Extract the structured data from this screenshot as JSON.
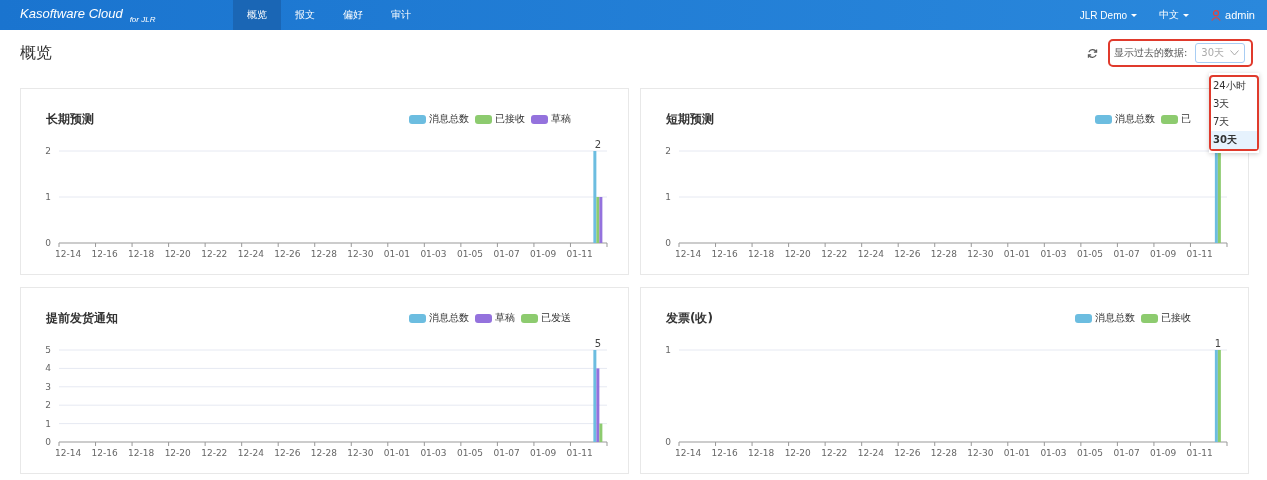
{
  "navbar": {
    "brand": "Kasoftware Cloud",
    "brand_suffix": "for JLR",
    "tabs": [
      {
        "label": "概览",
        "selected": true
      },
      {
        "label": "报文",
        "selected": false
      },
      {
        "label": "偏好",
        "selected": false
      },
      {
        "label": "审计",
        "selected": false
      }
    ],
    "menus": [
      {
        "kind": "dropdown",
        "label": "JLR Demo"
      },
      {
        "kind": "dropdown",
        "label": "中文"
      },
      {
        "kind": "user",
        "label": "admin"
      }
    ]
  },
  "page_title": "概览",
  "filter": {
    "label": "显示过去的数据:",
    "value": "30天",
    "expanded": true,
    "options": [
      {
        "label": "24小时",
        "selected": false
      },
      {
        "label": "3天",
        "selected": false
      },
      {
        "label": "7天",
        "selected": false
      },
      {
        "label": "30天",
        "selected": true
      }
    ]
  },
  "cards": [
    {
      "title": "长期预测",
      "chart_data": {
        "type": "bar",
        "stacked": false,
        "grid": true,
        "ylim": [
          0,
          2
        ],
        "yticks": [
          0,
          1,
          2
        ],
        "categories": [
          "12-14",
          null,
          "12-16",
          null,
          "12-18",
          null,
          "12-20",
          null,
          "12-22",
          null,
          "12-24",
          null,
          "12-26",
          null,
          "12-28",
          null,
          "12-30",
          null,
          "01-01",
          null,
          "01-03",
          null,
          "01-05",
          null,
          "01-07",
          null,
          "01-09",
          null,
          "01-11",
          null
        ],
        "series": [
          {
            "name": "消息总数",
            "color": "#6cbde0",
            "values": [
              0,
              0,
              0,
              0,
              0,
              0,
              0,
              0,
              0,
              0,
              0,
              0,
              0,
              0,
              0,
              0,
              0,
              0,
              0,
              0,
              0,
              0,
              0,
              0,
              0,
              0,
              0,
              0,
              0,
              2
            ]
          },
          {
            "name": "已接收",
            "color": "#8dcb6f",
            "values": [
              0,
              0,
              0,
              0,
              0,
              0,
              0,
              0,
              0,
              0,
              0,
              0,
              0,
              0,
              0,
              0,
              0,
              0,
              0,
              0,
              0,
              0,
              0,
              0,
              0,
              0,
              0,
              0,
              0,
              1
            ]
          },
          {
            "name": "草稿",
            "color": "#9472dd",
            "values": [
              0,
              0,
              0,
              0,
              0,
              0,
              0,
              0,
              0,
              0,
              0,
              0,
              0,
              0,
              0,
              0,
              0,
              0,
              0,
              0,
              0,
              0,
              0,
              0,
              0,
              0,
              0,
              0,
              0,
              1
            ]
          }
        ],
        "value_labels": [
          [
            null,
            null,
            null,
            null,
            null,
            null,
            null,
            null,
            null,
            null,
            null,
            null,
            null,
            null,
            null,
            null,
            null,
            null,
            null,
            null,
            null,
            null,
            null,
            null,
            null,
            null,
            null,
            null,
            null,
            "2"
          ],
          [
            null,
            null,
            null,
            null,
            null,
            null,
            null,
            null,
            null,
            null,
            null,
            null,
            null,
            null,
            null,
            null,
            null,
            null,
            null,
            null,
            null,
            null,
            null,
            null,
            null,
            null,
            null,
            null,
            null,
            null
          ],
          [
            null,
            null,
            null,
            null,
            null,
            null,
            null,
            null,
            null,
            null,
            null,
            null,
            null,
            null,
            null,
            null,
            null,
            null,
            null,
            null,
            null,
            null,
            null,
            null,
            null,
            null,
            null,
            null,
            null,
            null
          ]
        ]
      }
    },
    {
      "title": "短期预测",
      "chart_data": {
        "type": "bar",
        "stacked": false,
        "grid": true,
        "ylim": [
          0,
          2
        ],
        "yticks": [
          0,
          1,
          2
        ],
        "categories": [
          "12-14",
          null,
          "12-16",
          null,
          "12-18",
          null,
          "12-20",
          null,
          "12-22",
          null,
          "12-24",
          null,
          "12-26",
          null,
          "12-28",
          null,
          "12-30",
          null,
          "01-01",
          null,
          "01-03",
          null,
          "01-05",
          null,
          "01-07",
          null,
          "01-09",
          null,
          "01-11",
          null
        ],
        "series": [
          {
            "name": "消息总数",
            "color": "#6cbde0",
            "values": [
              0,
              0,
              0,
              0,
              0,
              0,
              0,
              0,
              0,
              0,
              0,
              0,
              0,
              0,
              0,
              0,
              0,
              0,
              0,
              0,
              0,
              0,
              0,
              0,
              0,
              0,
              0,
              0,
              0,
              2
            ]
          },
          {
            "name": "已",
            "color": "#8dcb6f",
            "values": [
              0,
              0,
              0,
              0,
              0,
              0,
              0,
              0,
              0,
              0,
              0,
              0,
              0,
              0,
              0,
              0,
              0,
              0,
              0,
              0,
              0,
              0,
              0,
              0,
              0,
              0,
              0,
              0,
              0,
              2
            ]
          }
        ]
      }
    },
    {
      "title": "提前发货通知",
      "chart_data": {
        "type": "bar",
        "stacked": false,
        "grid": true,
        "ylim": [
          0,
          5
        ],
        "yticks": [
          0,
          1,
          2,
          3,
          4,
          5
        ],
        "categories": [
          "12-14",
          null,
          "12-16",
          null,
          "12-18",
          null,
          "12-20",
          null,
          "12-22",
          null,
          "12-24",
          null,
          "12-26",
          null,
          "12-28",
          null,
          "12-30",
          null,
          "01-01",
          null,
          "01-03",
          null,
          "01-05",
          null,
          "01-07",
          null,
          "01-09",
          null,
          "01-11",
          null
        ],
        "series": [
          {
            "name": "消息总数",
            "color": "#6cbde0",
            "values": [
              0,
              0,
              0,
              0,
              0,
              0,
              0,
              0,
              0,
              0,
              0,
              0,
              0,
              0,
              0,
              0,
              0,
              0,
              0,
              0,
              0,
              0,
              0,
              0,
              0,
              0,
              0,
              0,
              0,
              5
            ]
          },
          {
            "name": "草稿",
            "color": "#9472dd",
            "values": [
              0,
              0,
              0,
              0,
              0,
              0,
              0,
              0,
              0,
              0,
              0,
              0,
              0,
              0,
              0,
              0,
              0,
              0,
              0,
              0,
              0,
              0,
              0,
              0,
              0,
              0,
              0,
              0,
              0,
              4
            ]
          },
          {
            "name": "已发送",
            "color": "#8dcb6f",
            "values": [
              0,
              0,
              0,
              0,
              0,
              0,
              0,
              0,
              0,
              0,
              0,
              0,
              0,
              0,
              0,
              0,
              0,
              0,
              0,
              0,
              0,
              0,
              0,
              0,
              0,
              0,
              0,
              0,
              0,
              1
            ]
          }
        ],
        "value_labels": [
          [
            null,
            null,
            null,
            null,
            null,
            null,
            null,
            null,
            null,
            null,
            null,
            null,
            null,
            null,
            null,
            null,
            null,
            null,
            null,
            null,
            null,
            null,
            null,
            null,
            null,
            null,
            null,
            null,
            null,
            "5"
          ],
          [
            null,
            null,
            null,
            null,
            null,
            null,
            null,
            null,
            null,
            null,
            null,
            null,
            null,
            null,
            null,
            null,
            null,
            null,
            null,
            null,
            null,
            null,
            null,
            null,
            null,
            null,
            null,
            null,
            null,
            null
          ],
          [
            null,
            null,
            null,
            null,
            null,
            null,
            null,
            null,
            null,
            null,
            null,
            null,
            null,
            null,
            null,
            null,
            null,
            null,
            null,
            null,
            null,
            null,
            null,
            null,
            null,
            null,
            null,
            null,
            null,
            null
          ]
        ]
      }
    },
    {
      "title": "发票(收)",
      "chart_data": {
        "type": "bar",
        "stacked": false,
        "grid": true,
        "ylim": [
          0,
          1
        ],
        "yticks": [
          0,
          1
        ],
        "categories": [
          "12-14",
          null,
          "12-16",
          null,
          "12-18",
          null,
          "12-20",
          null,
          "12-22",
          null,
          "12-24",
          null,
          "12-26",
          null,
          "12-28",
          null,
          "12-30",
          null,
          "01-01",
          null,
          "01-03",
          null,
          "01-05",
          null,
          "01-07",
          null,
          "01-09",
          null,
          "01-11",
          null
        ],
        "series": [
          {
            "name": "消息总数",
            "color": "#6cbde0",
            "values": [
              0,
              0,
              0,
              0,
              0,
              0,
              0,
              0,
              0,
              0,
              0,
              0,
              0,
              0,
              0,
              0,
              0,
              0,
              0,
              0,
              0,
              0,
              0,
              0,
              0,
              0,
              0,
              0,
              0,
              1
            ]
          },
          {
            "name": "已接收",
            "color": "#8dcb6f",
            "values": [
              0,
              0,
              0,
              0,
              0,
              0,
              0,
              0,
              0,
              0,
              0,
              0,
              0,
              0,
              0,
              0,
              0,
              0,
              0,
              0,
              0,
              0,
              0,
              0,
              0,
              0,
              0,
              0,
              0,
              1
            ]
          }
        ],
        "value_labels": [
          [
            null,
            null,
            null,
            null,
            null,
            null,
            null,
            null,
            null,
            null,
            null,
            null,
            null,
            null,
            null,
            null,
            null,
            null,
            null,
            null,
            null,
            null,
            null,
            null,
            null,
            null,
            null,
            null,
            null,
            "1"
          ],
          [
            null,
            null,
            null,
            null,
            null,
            null,
            null,
            null,
            null,
            null,
            null,
            null,
            null,
            null,
            null,
            null,
            null,
            null,
            null,
            null,
            null,
            null,
            null,
            null,
            null,
            null,
            null,
            null,
            null,
            null
          ]
        ]
      }
    }
  ]
}
